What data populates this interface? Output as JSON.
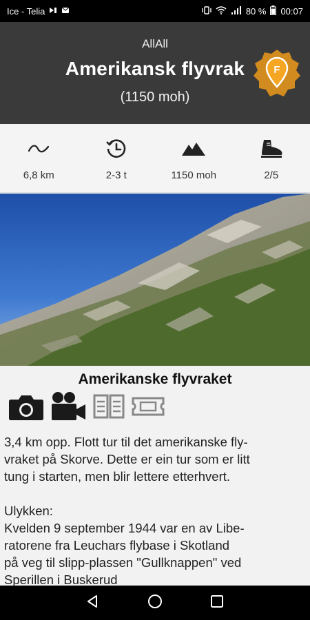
{
  "status_bar": {
    "carrier": "Ice - Telia",
    "battery": "80 %",
    "time": "00:07"
  },
  "header": {
    "subtitle": "AllAll",
    "title": "Amerikansk flyvrak",
    "altitude": "(1150 moh)",
    "badge_letter": "F",
    "badge_color": "#f5a623"
  },
  "stats": [
    {
      "icon": "distance-icon",
      "value": "6,8 km"
    },
    {
      "icon": "clock-history-icon",
      "value": "2-3 t"
    },
    {
      "icon": "mountain-icon",
      "value": "1150 moh"
    },
    {
      "icon": "hiking-boot-icon",
      "value": "2/5"
    }
  ],
  "content": {
    "title": "Amerikanske flyvraket",
    "media_icons": [
      "camera-icon",
      "video-camera-icon",
      "book-icon",
      "ticket-icon"
    ],
    "lines": [
      "3,4 km opp. Flott tur til det amerikanske fly-",
      "vraket på Skorve. Dette er ein tur som er litt",
      "tung i starten, men blir lettere etterhvert.",
      "",
      "Ulykken:",
      "Kvelden 9 september 1944 var en av Libe-",
      "ratorene fra Leuchars flybase i Skotland",
      "på veg til slipp-plassen \"Gullknappen\" ved",
      "Sperillen i Buskerud"
    ]
  }
}
